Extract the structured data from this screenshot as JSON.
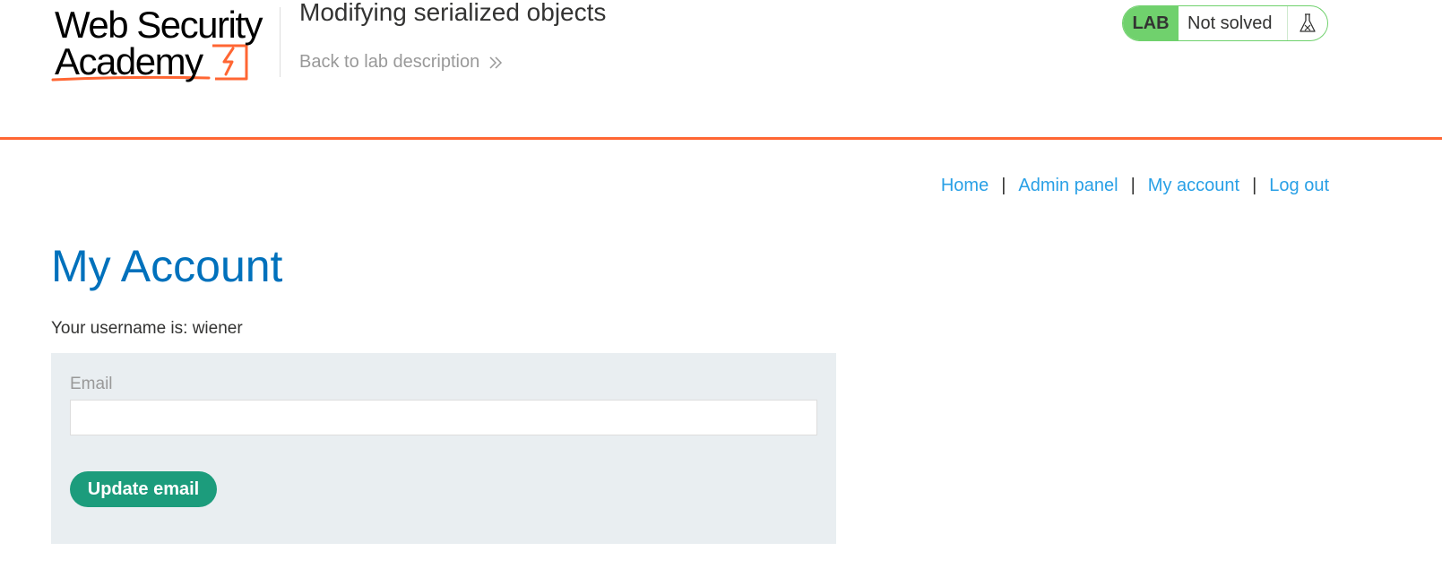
{
  "header": {
    "logo_line1": "Web Security",
    "logo_line2": "Academy",
    "lab_title": "Modifying serialized objects",
    "back_link": "Back to lab description",
    "lab_badge": "LAB",
    "lab_status": "Not solved",
    "icons": {
      "back": "double-chevron-right-icon",
      "status": "flask-icon"
    }
  },
  "nav": {
    "home": "Home",
    "admin_panel": "Admin panel",
    "my_account": "My account",
    "log_out": "Log out",
    "separator": "|"
  },
  "main": {
    "title": "My Account",
    "username_text": "Your username is: wiener",
    "email_label": "Email",
    "email_value": "",
    "update_button": "Update email"
  },
  "colors": {
    "accent_orange": "#ff6633",
    "link_blue": "#29a0e6",
    "title_blue": "#0071bc",
    "lab_green": "#70d16d",
    "button_green": "#1c9c7c",
    "form_bg": "#e9eef1"
  }
}
